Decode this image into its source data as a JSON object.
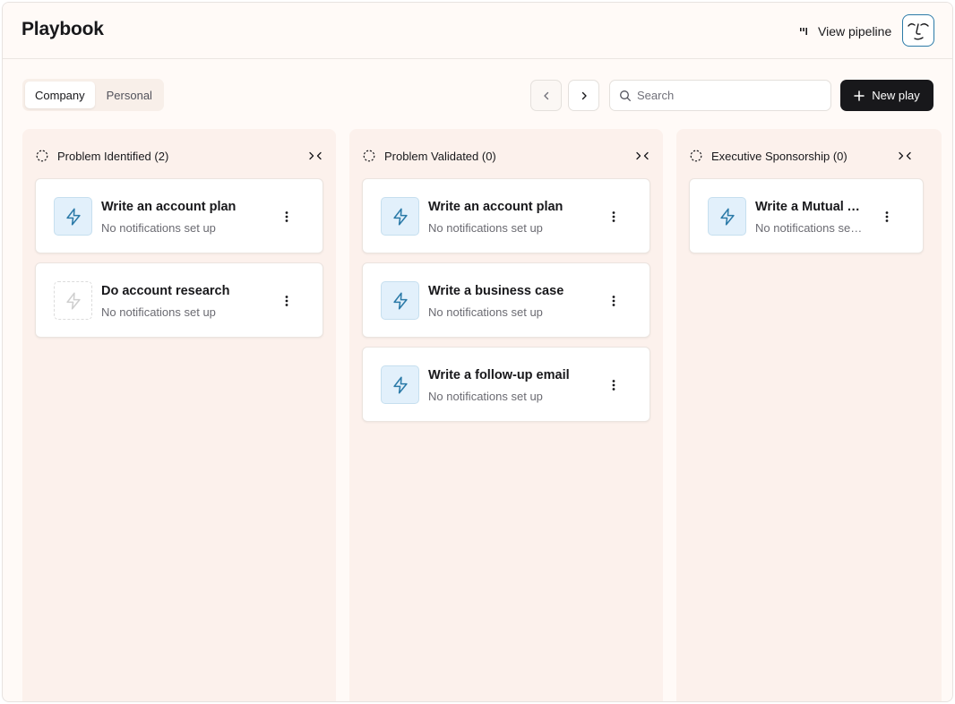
{
  "header": {
    "title": "Playbook",
    "view_pipeline_label": "View pipeline",
    "icons": {
      "pipeline": "pipeline-bars-icon",
      "avatar": "face-logo-icon"
    }
  },
  "toolbar": {
    "tabs": [
      {
        "label": "Company",
        "active": true
      },
      {
        "label": "Personal",
        "active": false
      }
    ],
    "prev_icon": "chevron-left-icon",
    "next_icon": "chevron-right-icon",
    "search": {
      "placeholder": "Search",
      "value": "",
      "icon": "search-icon"
    },
    "new_play_label": "New play",
    "new_play_icon": "plus-icon"
  },
  "columns": [
    {
      "title": "Problem Identified (2)",
      "status_icon": "dashed-circle-icon",
      "collapse_icon": "collapse-horizontal-icon",
      "cards": [
        {
          "title": "Write an account plan",
          "subtitle": "No notifications set up",
          "icon": "lightning-icon",
          "active": true
        },
        {
          "title": "Do account research",
          "subtitle": "No notifications set up",
          "icon": "lightning-icon",
          "active": false
        }
      ]
    },
    {
      "title": "Problem Validated (0)",
      "status_icon": "dashed-circle-icon",
      "collapse_icon": "collapse-horizontal-icon",
      "cards": [
        {
          "title": "Write an account plan",
          "subtitle": "No notifications set up",
          "icon": "lightning-icon",
          "active": true
        },
        {
          "title": "Write a business case",
          "subtitle": "No notifications set up",
          "icon": "lightning-icon",
          "active": true
        },
        {
          "title": "Write a follow-up email",
          "subtitle": "No notifications set up",
          "icon": "lightning-icon",
          "active": true
        }
      ]
    },
    {
      "title": "Executive Sponsorship (0)",
      "status_icon": "dashed-circle-icon",
      "collapse_icon": "collapse-horizontal-icon",
      "cards": [
        {
          "title": "Write a Mutual Action Plan",
          "subtitle": "No notifications set up",
          "icon": "lightning-icon",
          "active": true
        }
      ]
    }
  ],
  "colors": {
    "accent": "#2b7aa8",
    "icon_bg": "#e2f0fb",
    "column_bg": "#fcf1ec",
    "page_bg": "#fffaf7",
    "primary_button": "#18181b"
  }
}
